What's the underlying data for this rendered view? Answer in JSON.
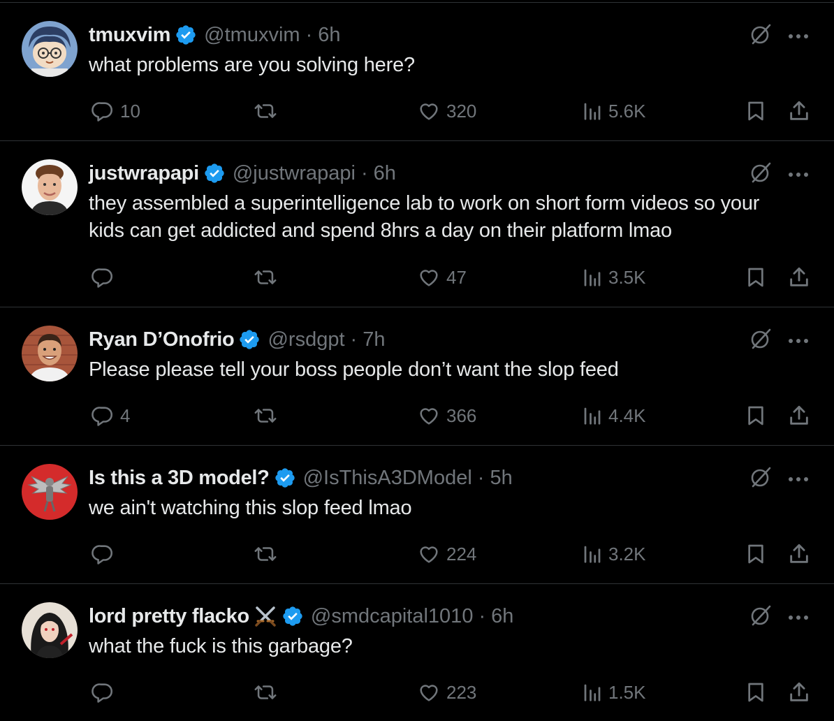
{
  "colors": {
    "background": "#000000",
    "text_primary": "#e7e9ea",
    "text_secondary": "#71767b",
    "verified_badge": "#1d9bf0",
    "divider": "#2f3336"
  },
  "icons": {
    "verified": "verified-badge-icon",
    "grok": "grok-icon",
    "more": "more-options-icon",
    "reply": "reply-icon",
    "retweet": "retweet-icon",
    "like": "like-icon",
    "views": "views-icon",
    "bookmark": "bookmark-icon",
    "share": "share-icon"
  },
  "tweets": [
    {
      "name": "tmuxvim",
      "handle": "@tmuxvim",
      "separator": "·",
      "time": "6h",
      "text": "what problems are you solving here?",
      "replies": "10",
      "retweets": "",
      "likes": "320",
      "views": "5.6K",
      "avatar": "cartoon-avatar"
    },
    {
      "name": "justwrapapi",
      "handle": "@justwrapapi",
      "separator": "·",
      "time": "6h",
      "text": "they assembled a superintelligence lab to work on short form videos so your kids can get addicted and spend 8hrs a day on their platform lmao",
      "replies": "",
      "retweets": "",
      "likes": "47",
      "views": "3.5K",
      "avatar": "photo-avatar"
    },
    {
      "name": "Ryan D’Onofrio",
      "handle": "@rsdgpt",
      "separator": "·",
      "time": "7h",
      "text": "Please please tell your boss people don’t want the slop feed",
      "replies": "4",
      "retweets": "",
      "likes": "366",
      "views": "4.4K",
      "avatar": "photo-avatar"
    },
    {
      "name": "Is this a 3D model?",
      "handle": "@IsThisA3DModel",
      "separator": "·",
      "time": "5h",
      "text": "we ain't watching this slop feed lmao",
      "replies": "",
      "retweets": "",
      "likes": "224",
      "views": "3.2K",
      "avatar": "statue-avatar"
    },
    {
      "name": "lord pretty flacko",
      "name_emoji": "crossed-swords-icon",
      "handle": "@smdcapital1010",
      "separator": "·",
      "time": "6h",
      "text": "what the fuck is this garbage?",
      "replies": "",
      "retweets": "",
      "likes": "223",
      "views": "1.5K",
      "avatar": "anime-avatar"
    }
  ]
}
